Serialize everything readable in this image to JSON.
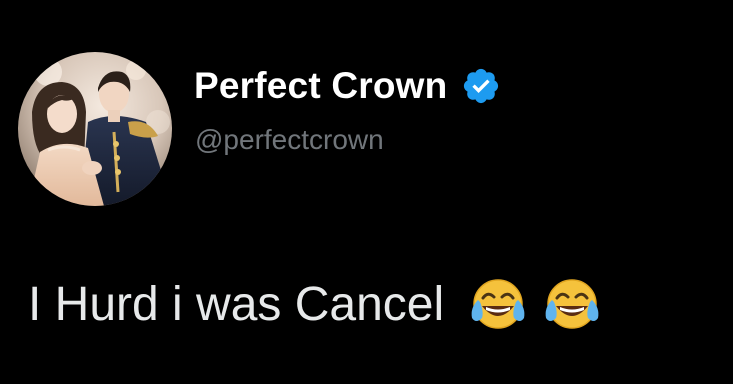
{
  "profile": {
    "display_name": "Perfect Crown",
    "handle": "@perfectcrown",
    "verified": true,
    "verified_badge_color": "#1d9bf0"
  },
  "tweet": {
    "text": "I Hurd i was Cancel",
    "emojis": [
      "face-with-tears-of-joy",
      "face-with-tears-of-joy"
    ]
  },
  "colors": {
    "background": "#000000",
    "name": "#ffffff",
    "handle": "#71767b",
    "text": "#e7e9ea"
  }
}
